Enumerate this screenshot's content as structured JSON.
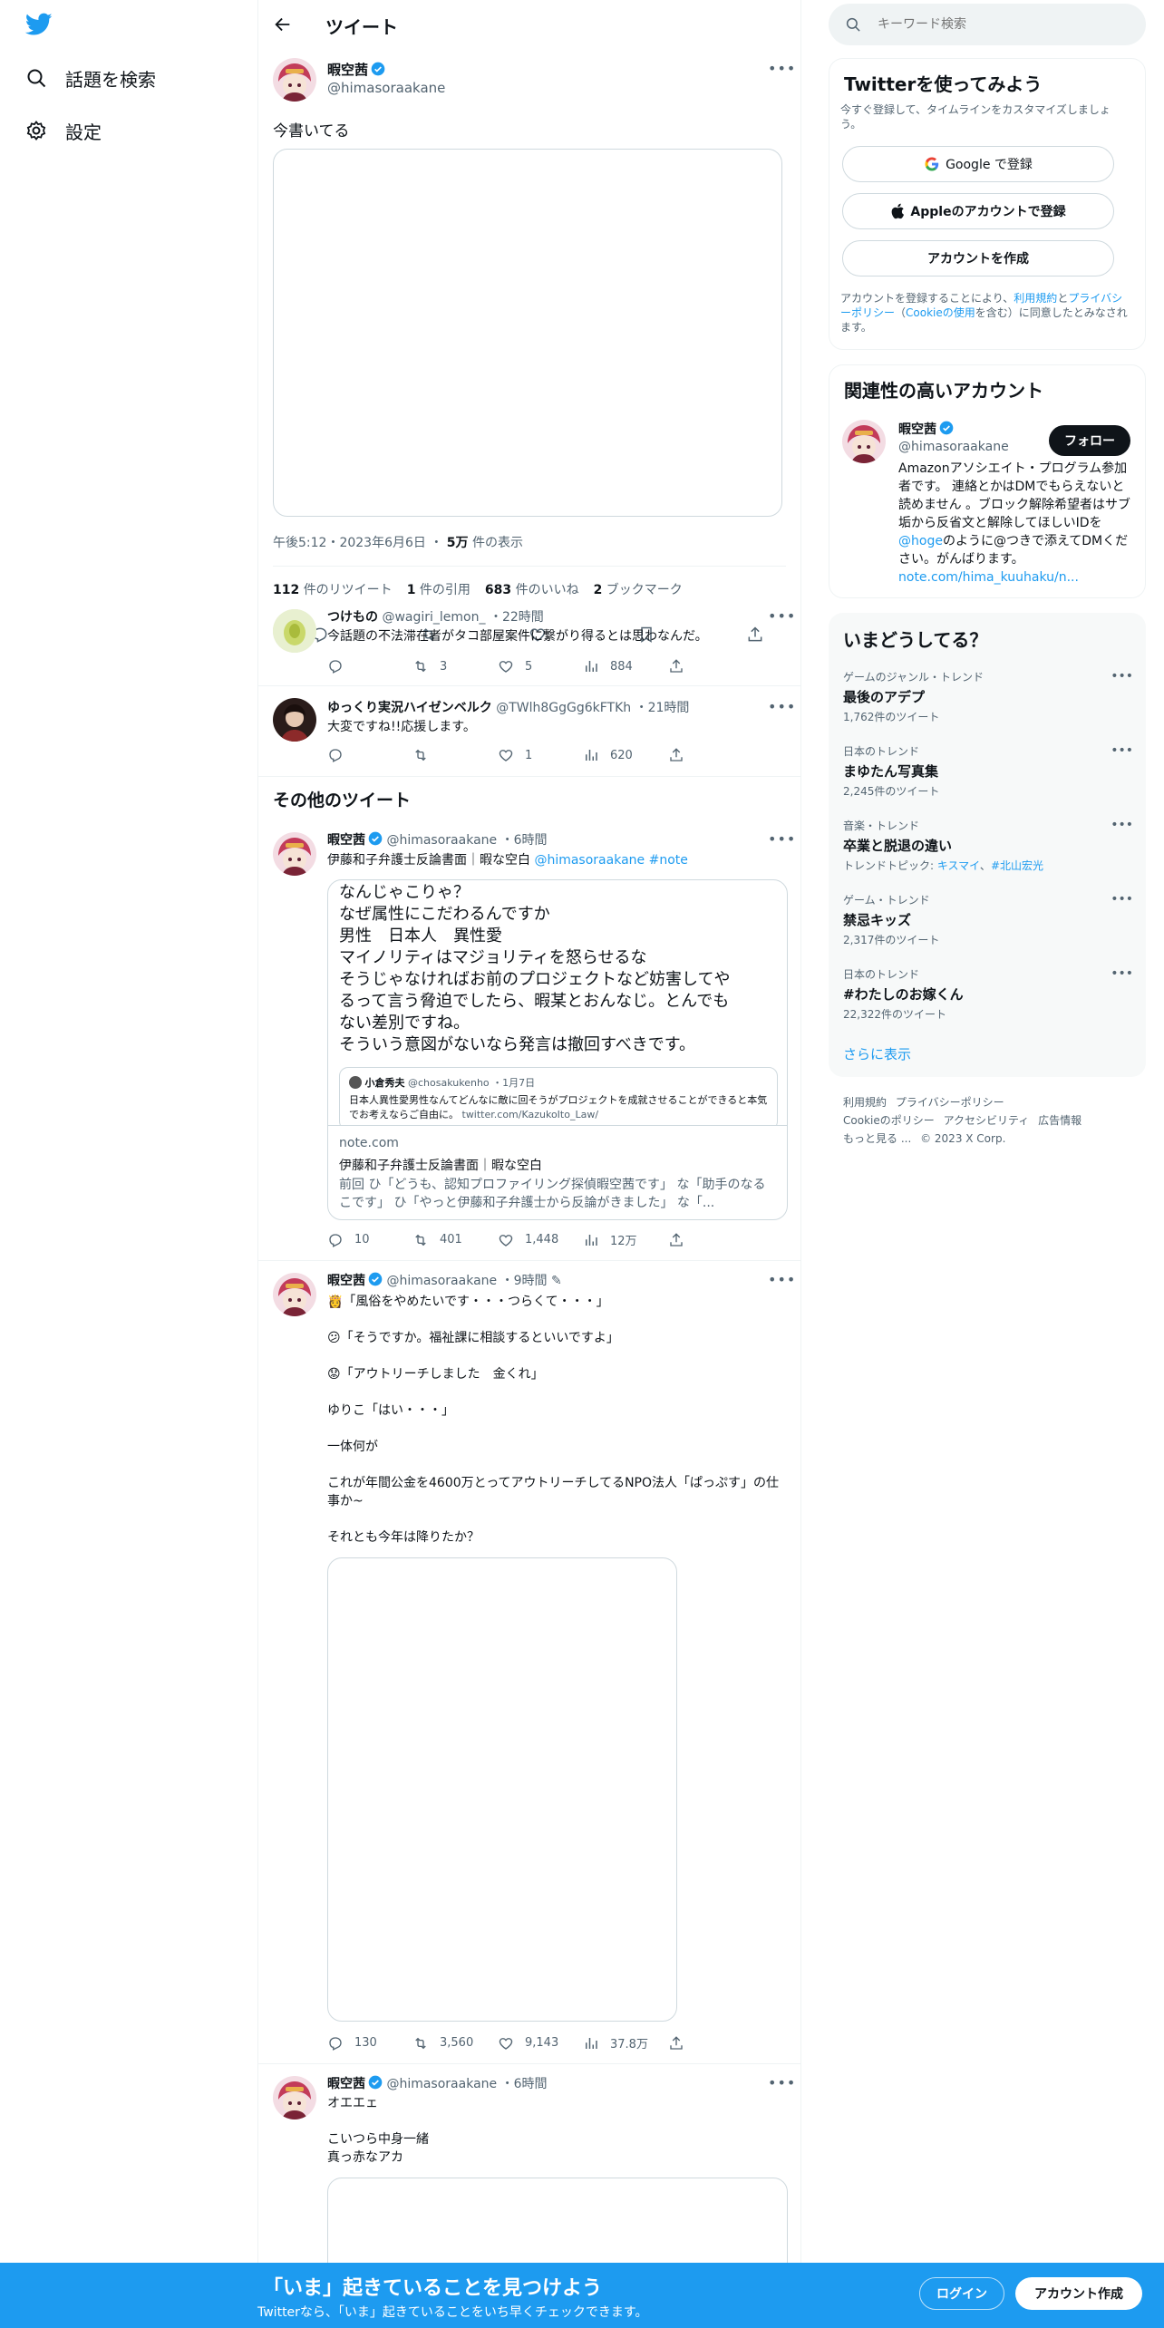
{
  "nav": {
    "explore_label": "話題を検索",
    "settings_label": "設定"
  },
  "header": {
    "title": "ツイート"
  },
  "main_tweet": {
    "author_name": "暇空茜",
    "author_handle": "@himasoraakane",
    "text": "今書いてる",
    "timestamp": "午後5:12・2023年6月6日",
    "views_count": "5万",
    "views_label": "件の表示",
    "retweets_count": "112",
    "retweets_label": "件のリツイート",
    "quotes_count": "1",
    "quotes_label": "件の引用",
    "likes_count": "683",
    "likes_label": "件のいいね",
    "bookmarks_count": "2",
    "bookmarks_label": "ブックマーク"
  },
  "replies": [
    {
      "author_name": "つけもの",
      "author_handle": "@wagiri_lemon_",
      "time": "22時間",
      "text": "今話題の不法滞在者がタコ部屋案件に繋がり得るとは思わなんだ。",
      "reply_count": "",
      "retweet_count": "3",
      "like_count": "5",
      "view_count": "884"
    },
    {
      "author_name": "ゆっくり実況ハイゼンベルク",
      "author_handle": "@TWlh8GgGg6kFTKh",
      "time": "21時間",
      "text": "大変ですね!!応援します。",
      "reply_count": "",
      "retweet_count": "",
      "like_count": "1",
      "view_count": "620"
    }
  ],
  "more_tweets_heading": "その他のツイート",
  "more_tweets": [
    {
      "author_name": "暇空茜",
      "author_handle": "@himasoraakane",
      "time": "6時間",
      "text": "伊藤和子弁護士反論書面｜暇な空白",
      "mention": "@himasoraakane",
      "hashtag": "#note",
      "card_lines": [
        "なんじゃこりゃ？",
        "なぜ属性にこだわるんですか",
        "男性　日本人　異性愛",
        "マイノリティはマジョリティを怒らせるな",
        "そうじゃなければお前のプロジェクトなど妨害してや",
        "るって言う脅迫でしたら、暇某とおんなじ。とんでも",
        "ない差別ですね。",
        "そういう意図がないなら発言は撤回すべきです。"
      ],
      "embedded_author": "小倉秀夫",
      "embedded_handle": "@chosakukenho",
      "embedded_date": "1月7日",
      "embedded_text": "日本人異性愛男性なんてどんなに敵に回そうがプロジェクトを成就させることができると本気でお考えならご自由に。",
      "embedded_link": "twitter.com/KazukoIto_Law/",
      "card_domain": "note.com",
      "card_title": "伊藤和子弁護士反論書面｜暇な空白",
      "card_desc": "前回 ひ「どうも、認知プロファイリング探偵暇空茜です」 な「助手のなるこです」 ひ「やっと伊藤和子弁護士から反論がきました」 な「...",
      "reply_count": "10",
      "retweet_count": "401",
      "like_count": "1,448",
      "view_count": "12万"
    },
    {
      "author_name": "暇空茜",
      "author_handle": "@himasoraakane",
      "time": "9時間",
      "text": "👸「風俗をやめたいです・・・つらくて・・・」\n\n😕「そうですか。福祉課に相談するといいですよ」\n\n😟「アウトリーチしました　金くれ」\n\nゆりこ「はい・・・」\n\n一体何が\n\nこれが年間公金を4600万とってアウトリーチしてるNPO法人「ぱっぷす」の仕事か~\n\nそれとも今年は降りたか？",
      "reply_count": "130",
      "retweet_count": "3,560",
      "like_count": "9,143",
      "view_count": "37.8万"
    },
    {
      "author_name": "暇空茜",
      "author_handle": "@himasoraakane",
      "time": "6時間",
      "text": "オエエェ\n\nこいつら中身一緒\n真っ赤なアカ"
    }
  ],
  "search": {
    "placeholder": "キーワード検索"
  },
  "signup": {
    "title": "Twitterを使ってみよう",
    "subtitle": "今すぐ登録して、タイムラインをカスタマイズしましょう。",
    "google_label": "Google で登録",
    "apple_label": "Appleのアカウントで登録",
    "create_label": "アカウントを作成",
    "legal_prefix": "アカウントを登録することにより、",
    "terms_link": "利用規約",
    "and": "と",
    "privacy_link": "プライバシーポリシー",
    "cookie_prefix": "（",
    "cookie_link": "Cookieの使用",
    "legal_suffix": "を含む）に同意したとみなされます。"
  },
  "relevant": {
    "title": "関連性の高いアカウント",
    "name": "暇空茜",
    "handle": "@himasoraakane",
    "follow_label": "フォロー",
    "bio_1": "Amazonアソシエイト・プログラム参加者です。 連絡とかはDMでもらえないと読めません 。ブロック解除希望者はサブ垢から反省文と解除してほしいIDを",
    "bio_mention": "@hoge",
    "bio_2": "のように@つきで添えてDMください。がんばります。",
    "bio_link": "note.com/hima_kuuhaku/n..."
  },
  "trends": {
    "title": "いまどうしてる？",
    "items": [
      {
        "category": "ゲームのジャンル・トレンド",
        "name": "最後のアデプ",
        "count": "1,762件のツイート"
      },
      {
        "category": "日本のトレンド",
        "name": "まゆたん写真集",
        "count": "2,245件のツイート"
      },
      {
        "category": "音楽・トレンド",
        "name": "卒業と脱退の違い",
        "topic_prefix": "トレンドトピック:",
        "topic_1": "キスマイ",
        "topic_2": "#北山宏光"
      },
      {
        "category": "ゲーム・トレンド",
        "name": "禁忌キッズ",
        "count": "2,317件のツイート"
      },
      {
        "category": "日本のトレンド",
        "name": "#わたしのお嫁くん",
        "count": "22,322件のツイート"
      }
    ],
    "show_more": "さらに表示"
  },
  "footer": {
    "terms": "利用規約",
    "privacy": "プライバシーポリシー",
    "cookie": "Cookieのポリシー",
    "accessibility": "アクセシビリティ",
    "ads": "広告情報",
    "more": "もっと見る ...",
    "copyright": "© 2023 X Corp."
  },
  "banner": {
    "title": "「いま」起きていることを見つけよう",
    "subtitle": "Twitterなら、「いま」起きていることをいち早くチェックできます。",
    "login_label": "ログイン",
    "signup_label": "アカウント作成"
  },
  "colors": {
    "brand": "#1d9bf0",
    "text": "#0f1419",
    "muted": "#536471",
    "border": "#eff3f4",
    "panel_bg": "#f7f9f9"
  }
}
